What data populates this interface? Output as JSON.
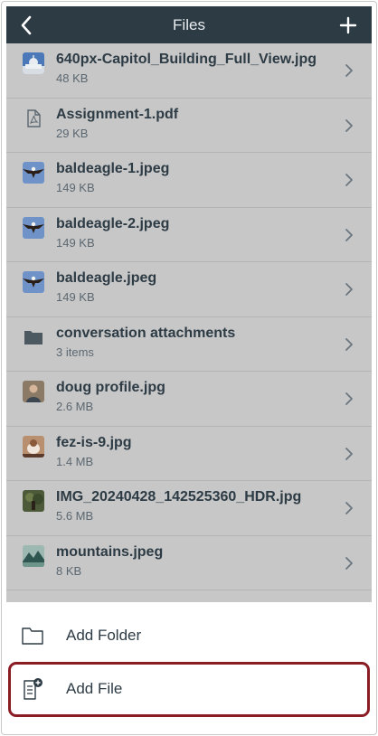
{
  "navbar": {
    "title": "Files",
    "back_icon": "chevron-left-icon",
    "add_icon": "plus-icon",
    "background": "#2d3b45"
  },
  "files": [
    {
      "name": "640px-Capitol_Building_Full_View.jpg",
      "meta": "48 KB",
      "kind": "image-capitol"
    },
    {
      "name": "Assignment-1.pdf",
      "meta": "29 KB",
      "kind": "pdf-icon"
    },
    {
      "name": "baldeagle-1.jpeg",
      "meta": "149 KB",
      "kind": "image-eagle"
    },
    {
      "name": "baldeagle-2.jpeg",
      "meta": "149 KB",
      "kind": "image-eagle"
    },
    {
      "name": "baldeagle.jpeg",
      "meta": "149 KB",
      "kind": "image-eagle"
    },
    {
      "name": "conversation attachments",
      "meta": "3 items",
      "kind": "folder-icon"
    },
    {
      "name": "doug profile.jpg",
      "meta": "2.6 MB",
      "kind": "image-person"
    },
    {
      "name": "fez-is-9.jpg",
      "meta": "1.4 MB",
      "kind": "image-cat"
    },
    {
      "name": "IMG_20240428_142525360_HDR.jpg",
      "meta": "5.6 MB",
      "kind": "image-outdoor"
    },
    {
      "name": "mountains.jpeg",
      "meta": "8 KB",
      "kind": "image-mountains"
    }
  ],
  "sheet": {
    "add_folder": "Add Folder",
    "add_file": "Add File",
    "highlight_color": "#8a1c24"
  }
}
